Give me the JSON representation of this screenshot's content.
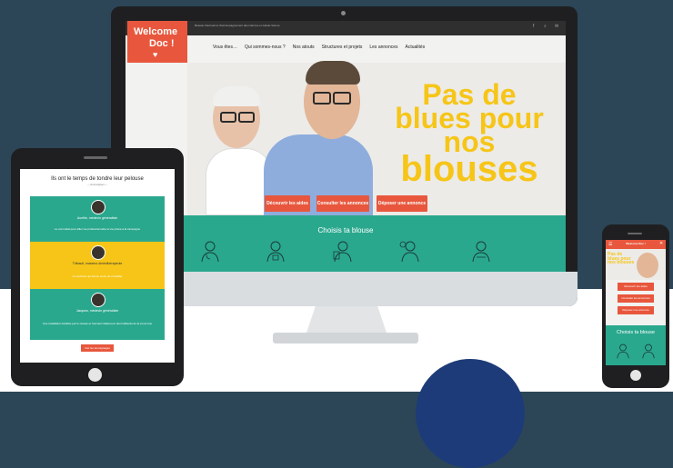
{
  "brand": {
    "line1": "Welcome",
    "line2": "Doc !",
    "heart": "♥"
  },
  "site": {
    "tagline": "Réseau d'accueil et d'accompagnement des internes en Haute-Vienne",
    "nav": [
      "Vous êtes…",
      "Qui sommes-nous ?",
      "Nos atouts",
      "Structures et projets",
      "Les annonces",
      "Actualités"
    ],
    "social": [
      "f",
      "⌕",
      "✉"
    ],
    "headline": {
      "l1": "Pas de",
      "l2": "blues pour",
      "l3": "nos",
      "l4": "blouses"
    },
    "buttons": [
      "Découvrir les aides",
      "Consulter les annonces",
      "Déposer une annonce"
    ],
    "section_title": "Choisis ta blouse"
  },
  "tablet": {
    "title": "Ils ont le temps de tondre leur pelouse",
    "subtitle": "— ils témoignent —",
    "cards": [
      {
        "name": "Aurélie, médecin généraliste",
        "text": "Le coin idéal pour allier vie professionnelle et vie privée à la campagne",
        "color": "#2aa88e"
      },
      {
        "name": "Thibault, masseur-kinésithérapeute",
        "text": "Un territoire qui donne envie de s'installer",
        "color": "#f6c518"
      },
      {
        "name": "Jacques, médecin généraliste",
        "text": "Une installation facilitée par le réseau et l'accueil chaleureux des habitants de la commune",
        "color": "#2aa88e"
      }
    ],
    "button": "Voir les témoignages"
  },
  "phone": {
    "logo": "Welcome Doc !",
    "menu_icon": "☰",
    "close_icon": "✕",
    "headline": "Pas de blues pour nos blouses",
    "buttons": [
      "Découvrir les aides",
      "Consulter les annonces",
      "Déposer une annonce"
    ],
    "section_title": "Choisis ta blouse"
  },
  "colors": {
    "accent": "#e8573d",
    "yellow": "#f6c518",
    "teal": "#2aa88e",
    "navy": "#2c4658"
  }
}
